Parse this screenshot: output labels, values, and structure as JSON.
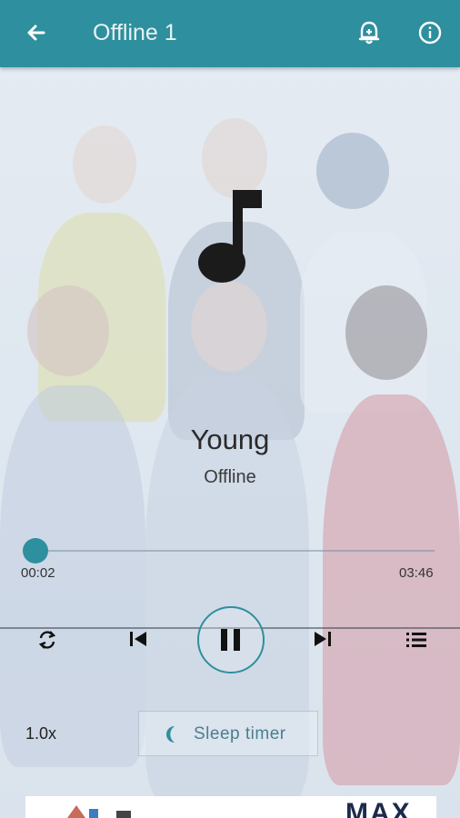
{
  "topbar": {
    "title": "Offline 1",
    "back_icon": "arrow-left-icon",
    "alarm_icon": "alarm-bell-icon",
    "info_icon": "info-icon"
  },
  "player": {
    "title": "Young",
    "subtitle": "Offline",
    "current_time": "00:02",
    "total_time": "03:46",
    "progress": 0.01,
    "speed": "1.0x",
    "sleep_timer_label": "Sleep timer",
    "state": "playing"
  },
  "ad": {
    "brand_mark": "MAX"
  },
  "colors": {
    "accent": "#2e8f9e",
    "background": "#dfe5ee"
  }
}
